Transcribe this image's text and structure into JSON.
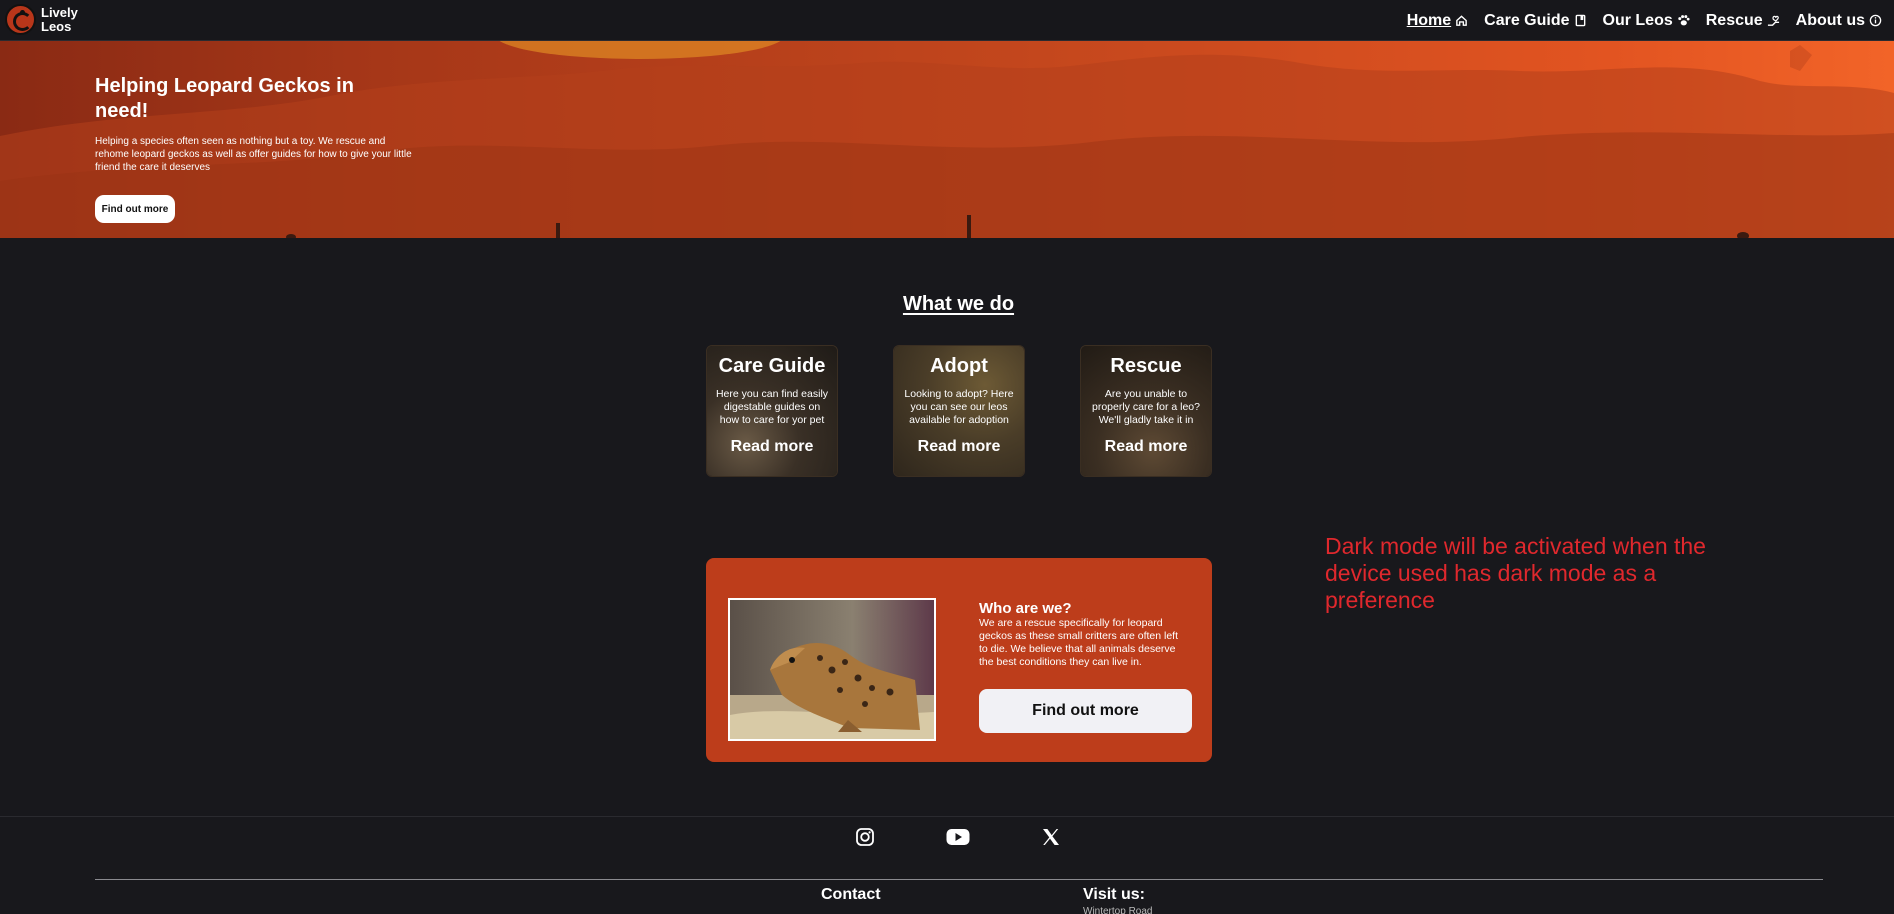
{
  "brand": {
    "name": "Lively Leos",
    "logo_icon": "gecko-logo-icon"
  },
  "nav": [
    {
      "label": "Home",
      "icon": "home-icon",
      "active": true
    },
    {
      "label": "Care Guide",
      "icon": "book-icon",
      "active": false
    },
    {
      "label": "Our Leos",
      "icon": "paw-icon",
      "active": false
    },
    {
      "label": "Rescue",
      "icon": "rescue-icon",
      "active": false
    },
    {
      "label": "About us",
      "icon": "info-icon",
      "active": false
    }
  ],
  "hero": {
    "title": "Helping Leopard Geckos in need!",
    "text": "Helping a species often seen as nothing but a toy. We rescue and rehome leopard geckos as well as offer guides for how to give your little friend the care it deserves",
    "button": "Find out more"
  },
  "what_we_do": {
    "title": "What we do",
    "cards": [
      {
        "title": "Care Guide",
        "text": "Here you can find easily digestable guides on how to care for yor pet",
        "link": "Read more"
      },
      {
        "title": "Adopt",
        "text": "Looking to adopt? Here you can see our leos available for adoption",
        "link": "Read more"
      },
      {
        "title": "Rescue",
        "text": "Are you unable to properly care for a leo? We'll gladly take it in",
        "link": "Read more"
      }
    ]
  },
  "who": {
    "title": "Who are we?",
    "text": "We are a rescue specifically for leopard geckos as these small critters are often left to die. We believe that all animals deserve the best conditions they can live in.",
    "button": "Find out more"
  },
  "note": "Dark mode will be activated when the device used has dark mode as a preference",
  "footer": {
    "social": [
      "instagram-icon",
      "youtube-icon",
      "x-icon"
    ],
    "contact_heading": "Contact",
    "visit_heading": "Visit us:",
    "visit_partial": "Wintertop Road"
  },
  "colors": {
    "accent": "#bd3d1b",
    "background": "#18181c",
    "note": "#e0282d"
  }
}
